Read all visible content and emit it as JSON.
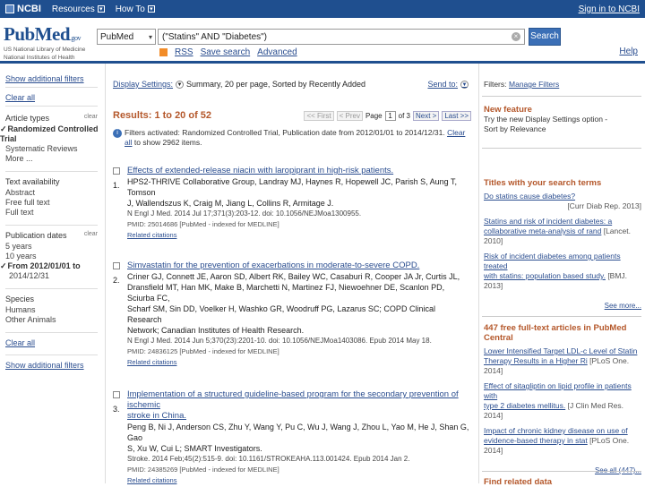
{
  "topbar": {
    "brand": "NCBI",
    "resources": "Resources",
    "howto": "How To",
    "signin": "Sign in to NCBI"
  },
  "logo": {
    "name": "PubMed",
    "suffix": ".gov",
    "nlm_line1": "US National Library of Medicine",
    "nlm_line2": "National Institutes of Health"
  },
  "search": {
    "database": "PubMed",
    "query": "(\"Statins\" AND \"Diabetes\")",
    "button": "Search",
    "rss": "RSS",
    "save_search": "Save search",
    "advanced": "Advanced",
    "help": "Help"
  },
  "sidebar": {
    "show_filters": "Show additional filters",
    "clear_all_top": "Clear all",
    "article_types": {
      "header": "Article types",
      "clear": "clear",
      "items": [
        "Randomized Controlled Trial",
        "Systematic Reviews",
        "More ..."
      ]
    },
    "text_availability": {
      "header": "Text availability",
      "items": [
        "Abstract",
        "Free full text",
        "Full text"
      ]
    },
    "pub_dates": {
      "header": "Publication dates",
      "clear": "clear",
      "items": [
        "5 years",
        "10 years"
      ],
      "selected_line1": "From 2012/01/01 to",
      "selected_line2": "2014/12/31"
    },
    "species": {
      "header": "Species",
      "items": [
        "Humans",
        "Other Animals"
      ]
    },
    "clear_all": "Clear all",
    "show_filters_bottom": "Show additional filters"
  },
  "display": {
    "settings_label": "Display Settings:",
    "settings_value": "Summary, 20 per page, Sorted by Recently Added",
    "send_to": "Send to:"
  },
  "results": {
    "title": "Results: 1 to 20 of 52",
    "pager": {
      "first": "<< First",
      "prev": "< Prev",
      "page_label": "Page",
      "page": "1",
      "of": "of 3",
      "next": "Next >",
      "last": "Last >>"
    },
    "filter_msg": "Filters activated: Randomized Controlled Trial, Publication date from 2012/01/01 to 2014/12/31.",
    "filter_clear": "Clear all",
    "filter_msg2": "to show 2962 items.",
    "items": [
      {
        "num": "1.",
        "title": "Effects of extended-release niacin with laropiprant in high-risk patients.",
        "authors1": "HPS2-THRIVE Collaborative Group, Landray MJ, Haynes R, Hopewell JC, Parish S, Aung T, Tomson",
        "authors2": "J, Wallendszus K, Craig M, Jiang L, Collins R, Armitage J.",
        "citation": "N Engl J Med. 2014 Jul 17;371(3):203-12. doi: 10.1056/NEJMoa1300955.",
        "pmid": "PMID: 25014686 [PubMed - indexed for MEDLINE]",
        "related": "Related citations"
      },
      {
        "num": "2.",
        "title": "Simvastatin for the prevention of exacerbations in moderate-to-severe COPD.",
        "authors1": "Criner GJ, Connett JE, Aaron SD, Albert RK, Bailey WC, Casaburi R, Cooper JA Jr, Curtis JL,",
        "authors2": "Dransfield MT, Han MK, Make B, Marchetti N, Martinez FJ, Niewoehner DE, Scanlon PD, Sciurba FC,",
        "authors3": "Scharf SM, Sin DD, Voelker H, Washko GR, Woodruff PG, Lazarus SC; COPD Clinical Research",
        "authors4": "Network; Canadian Institutes of Health Research.",
        "citation": "N Engl J Med. 2014 Jun 5;370(23):2201-10. doi: 10.1056/NEJMoa1403086. Epub 2014 May 18.",
        "pmid": "PMID: 24836125 [PubMed - indexed for MEDLINE]",
        "related": "Related citations"
      },
      {
        "num": "3.",
        "title": "Implementation of a structured guideline-based program for the secondary prevention of ischemic",
        "title2": "stroke in China.",
        "authors1": "Peng B, Ni J, Anderson CS, Zhu Y, Wang Y, Pu C, Wu J, Wang J, Zhou L, Yao M, He J, Shan G, Gao",
        "authors2": "S, Xu W, Cui L; SMART Investigators.",
        "citation": "Stroke. 2014 Feb;45(2):515-9. doi: 10.1161/STROKEAHA.113.001424. Epub 2014 Jan 2.",
        "pmid": "PMID: 24385269 [PubMed - indexed for MEDLINE]",
        "related": "Related citations"
      }
    ]
  },
  "right": {
    "filters_label": "Filters:",
    "manage_filters": "Manage Filters",
    "new_feature": {
      "header": "New feature",
      "text1": "Try the new Display Settings option -",
      "text2": "Sort by Relevance"
    },
    "titles": {
      "header": "Titles with your search terms",
      "items": [
        {
          "title": "Do statins cause diabetes?",
          "src": "[Curr Diab Rep. 2013]"
        },
        {
          "title1": "Statins and risk of incident diabetes: a",
          "title2": "collaborative meta-analysis of rand",
          "src": "[Lancet. 2010]"
        },
        {
          "title1": "Risk of incident diabetes among patients treated",
          "title2": "with statins: population based study.",
          "src": "[BMJ. 2013]"
        }
      ],
      "see_more": "See more..."
    },
    "free_full": {
      "header1": "447 free full-text articles in PubMed",
      "header2": "Central",
      "items": [
        {
          "t1": "Lower Intensified Target LDL-c Level of Statin",
          "t2": "Therapy Results in a Higher Ri",
          "src": "[PLoS One. 2014]"
        },
        {
          "t1": "Effect of sitagliptin on lipid profile in patients with",
          "t2": "type 2 diabetes mellitus.",
          "src": "[J Clin Med Res. 2014]"
        },
        {
          "t1": "Impact of chronic kidney disease on use of",
          "t2": "evidence-based therapy in stat",
          "src": "[PLoS One. 2014]"
        }
      ],
      "see_all": "See all (447)..."
    },
    "find_related": "Find related data"
  }
}
